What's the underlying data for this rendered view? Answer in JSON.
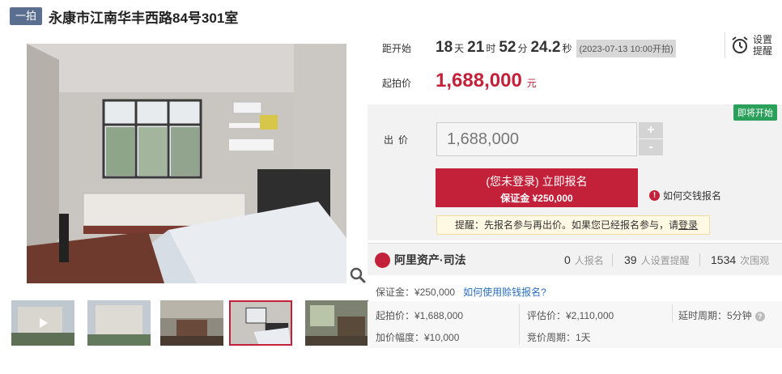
{
  "header": {
    "round_tag": "一拍",
    "title": "永康市江南华丰西路84号301室"
  },
  "countdown": {
    "label": "距开始",
    "days": "18",
    "days_unit": "天",
    "hours": "21",
    "hours_unit": "时",
    "minutes": "52",
    "minutes_unit": "分",
    "seconds": "24.2",
    "seconds_unit": "秒",
    "start_time": "(2023-07-13 10:00开拍)"
  },
  "reminder": {
    "line1": "设置",
    "line2": "提醒"
  },
  "start_price": {
    "label": "起拍价",
    "value": "1,688,000",
    "unit": "元"
  },
  "bid": {
    "status_badge": "即将开始",
    "label": "出价",
    "input_value": "1,688,000",
    "increase": "+",
    "decrease": "-",
    "signup_line1": "(您未登录) 立即报名",
    "signup_line2": "保证金 ¥250,000",
    "pay_help": "如何交钱报名",
    "notice_prefix": "提醒：先报名参与再出价。如果您已经报名参与，请",
    "notice_link": "登录"
  },
  "stats": {
    "brand": "阿里资产·司法",
    "signups": "0",
    "signups_label": "人报名",
    "reminders": "39",
    "reminders_label": "人设置提醒",
    "views": "1534",
    "views_label": "次围观"
  },
  "deposit": {
    "text": "保证金：¥250,000",
    "link": "如何使用赊钱报名?"
  },
  "info": {
    "start_price": "起拍价：¥1,688,000",
    "appraisal": "评估价：¥2,110,000",
    "delay": "延时周期：5分钟",
    "increment": "加价幅度：¥10,000",
    "cycle": "竞价周期：1天"
  },
  "icons": {
    "zoom": "zoom-icon",
    "alarm": "alarm-clock-icon",
    "info": "info-icon",
    "help": "help-icon",
    "brand": "ali-logo-icon"
  },
  "colors": {
    "accent": "#c3213a",
    "tag": "#5a6e8f",
    "badge": "#2aa05a",
    "link": "#2a6dbf"
  }
}
